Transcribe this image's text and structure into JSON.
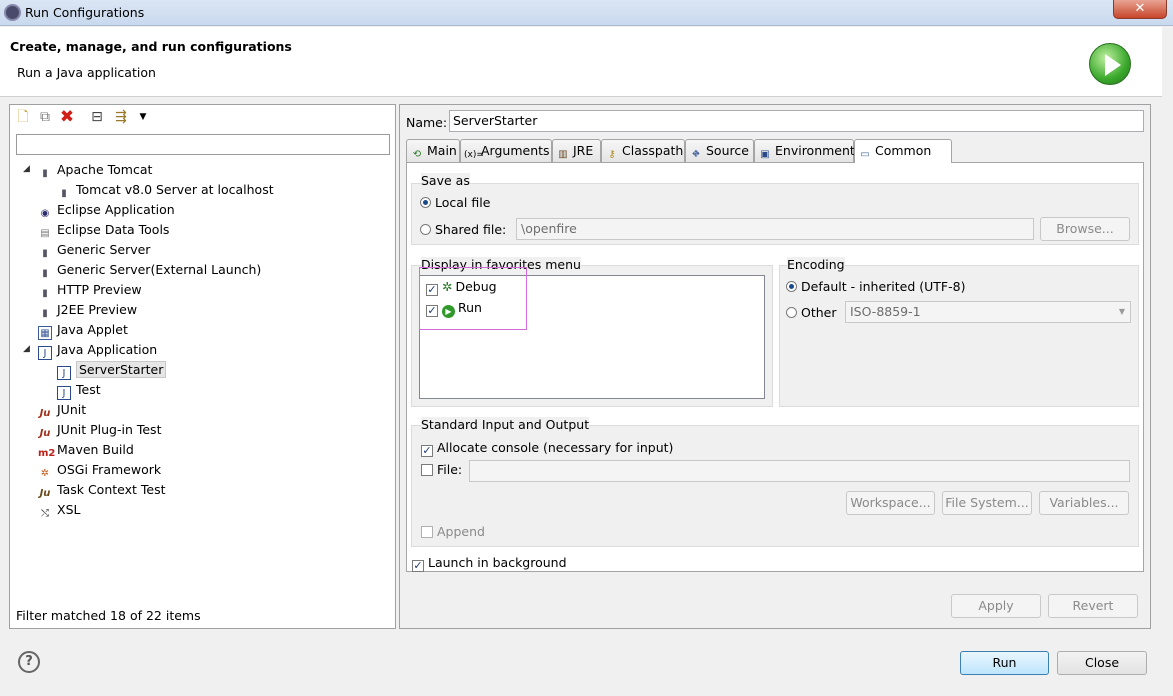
{
  "window": {
    "title": "Run Configurations",
    "close_symbol": "✕"
  },
  "header": {
    "title": "Create, manage, and run configurations",
    "subtitle": "Run a Java application"
  },
  "left_panel": {
    "filter_value": "",
    "tree": [
      {
        "label": "Apache Tomcat",
        "icon": "server-icon",
        "level": 0,
        "expanded": true
      },
      {
        "label": "Tomcat v8.0 Server at localhost",
        "icon": "server-icon",
        "level": 1
      },
      {
        "label": "Eclipse Application",
        "icon": "eclipse-icon",
        "level": 0
      },
      {
        "label": "Eclipse Data Tools",
        "icon": "database-icon",
        "level": 0
      },
      {
        "label": "Generic Server",
        "icon": "server-icon",
        "level": 0
      },
      {
        "label": "Generic Server(External Launch)",
        "icon": "server-icon",
        "level": 0
      },
      {
        "label": "HTTP Preview",
        "icon": "server-icon",
        "level": 0
      },
      {
        "label": "J2EE Preview",
        "icon": "server-icon",
        "level": 0
      },
      {
        "label": "Java Applet",
        "icon": "applet-icon",
        "level": 0
      },
      {
        "label": "Java Application",
        "icon": "java-app-icon",
        "level": 0,
        "expanded": true
      },
      {
        "label": "ServerStarter",
        "icon": "java-app-icon",
        "level": 1,
        "selected": true
      },
      {
        "label": "Test",
        "icon": "java-app-icon",
        "level": 1
      },
      {
        "label": "JUnit",
        "icon": "junit-icon",
        "level": 0
      },
      {
        "label": "JUnit Plug-in Test",
        "icon": "junit-plugin-icon",
        "level": 0
      },
      {
        "label": "Maven Build",
        "icon": "maven-icon",
        "level": 0
      },
      {
        "label": "OSGi Framework",
        "icon": "osgi-icon",
        "level": 0
      },
      {
        "label": "Task Context Test",
        "icon": "task-test-icon",
        "level": 0
      },
      {
        "label": "XSL",
        "icon": "xsl-icon",
        "level": 0
      }
    ],
    "filter_status": "Filter matched 18 of 22 items"
  },
  "config": {
    "name_label": "Name:",
    "name_value": "ServerStarter",
    "tabs": [
      {
        "label": "Main",
        "icon": "main-tab-icon"
      },
      {
        "label": "Arguments",
        "icon": "arguments-tab-icon"
      },
      {
        "label": "JRE",
        "icon": "jre-tab-icon"
      },
      {
        "label": "Classpath",
        "icon": "classpath-tab-icon"
      },
      {
        "label": "Source",
        "icon": "source-tab-icon"
      },
      {
        "label": "Environment",
        "icon": "environment-tab-icon"
      },
      {
        "label": "Common",
        "icon": "common-tab-icon",
        "active": true
      }
    ],
    "save_as": {
      "label": "Save as",
      "local_file": "Local file",
      "shared_file": "Shared file:",
      "shared_path": "\\openfire",
      "browse": "Browse..."
    },
    "favorites": {
      "label": "Display in favorites menu",
      "items": [
        {
          "label": "Debug",
          "checked": true,
          "icon": "debug-icon"
        },
        {
          "label": "Run",
          "checked": true,
          "icon": "run-icon"
        }
      ]
    },
    "encoding": {
      "label": "Encoding",
      "default": "Default - inherited (UTF-8)",
      "other": "Other",
      "other_value": "ISO-8859-1"
    },
    "std_io": {
      "label": "Standard Input and Output",
      "allocate": "Allocate console (necessary for input)",
      "file": "File:",
      "workspace": "Workspace...",
      "file_system": "File System...",
      "variables": "Variables...",
      "append": "Append"
    },
    "launch_bg": "Launch in background",
    "apply": "Apply",
    "revert": "Revert"
  },
  "footer": {
    "run": "Run",
    "close": "Close",
    "help": "?"
  }
}
